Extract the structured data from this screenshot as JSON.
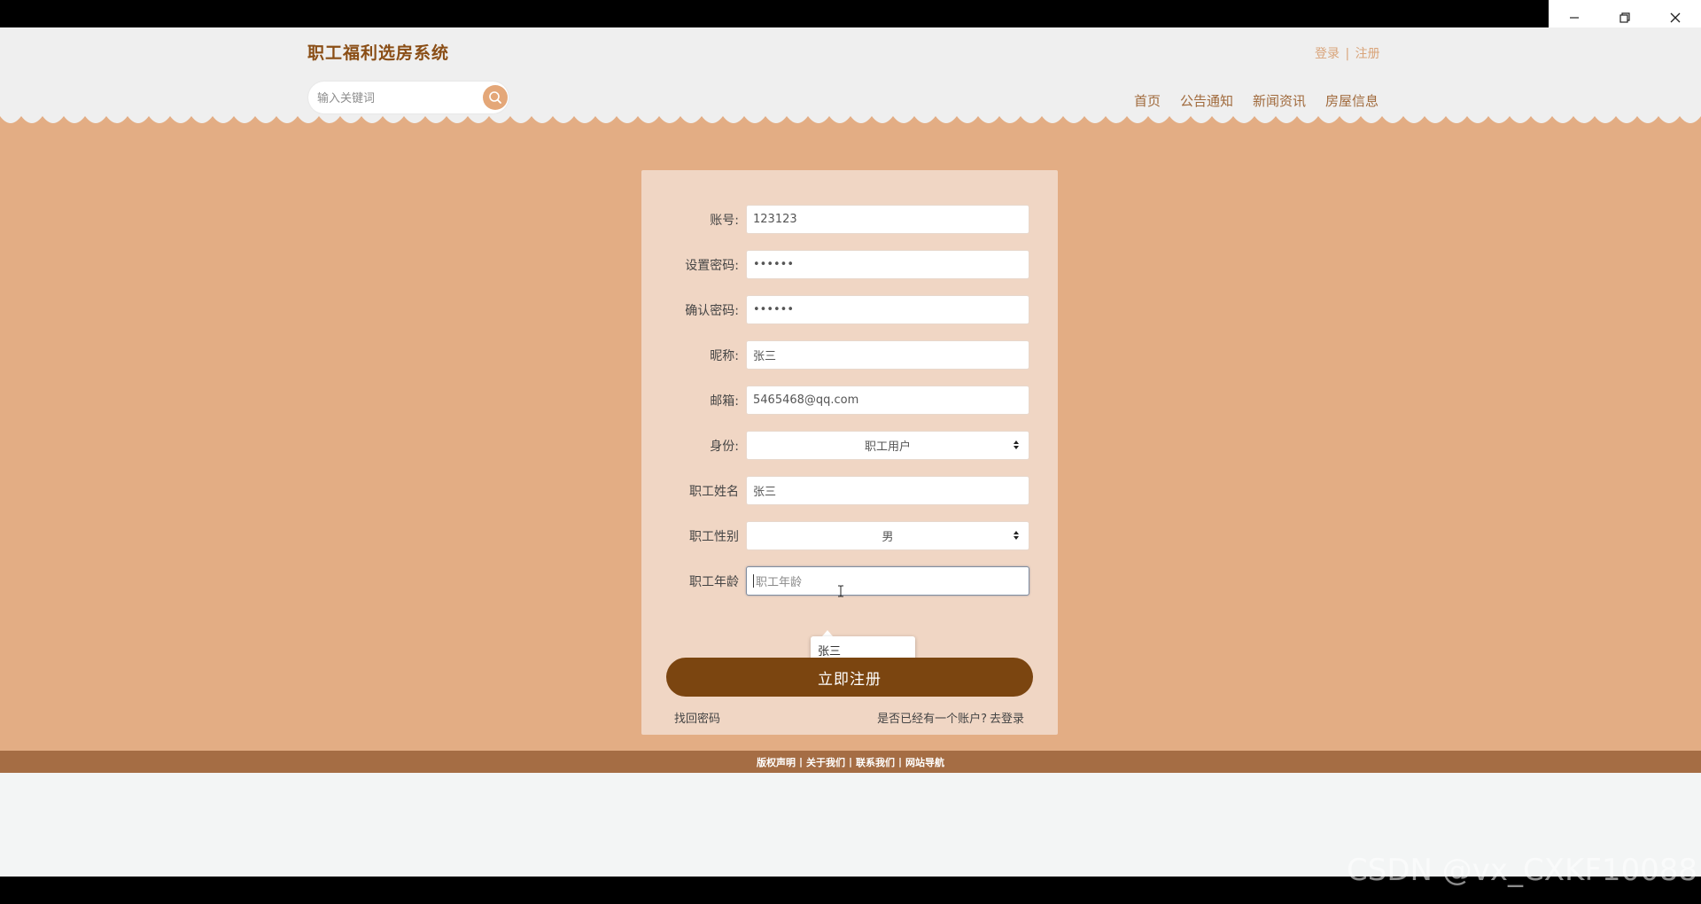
{
  "header": {
    "site_title": "职工福利选房系统",
    "login_link": "登录",
    "separator": "|",
    "register_link": "注册",
    "search": {
      "placeholder": "输入关键词"
    },
    "nav": [
      "首页",
      "公告通知",
      "新闻资讯",
      "房屋信息"
    ]
  },
  "form": {
    "fields": [
      {
        "label": "账号:",
        "value": "123123",
        "type": "text"
      },
      {
        "label": "设置密码:",
        "value": "••••••",
        "type": "password"
      },
      {
        "label": "确认密码:",
        "value": "••••••",
        "type": "password"
      },
      {
        "label": "昵称:",
        "value": "张三",
        "type": "text"
      },
      {
        "label": "邮箱:",
        "value": "5465468@qq.com",
        "type": "text"
      },
      {
        "label": "身份:",
        "value": "职工用户",
        "type": "select"
      },
      {
        "label": "职工姓名",
        "value": "张三",
        "type": "text"
      },
      {
        "label": "职工性别",
        "value": "男",
        "type": "select"
      },
      {
        "label": "职工年龄",
        "value": "",
        "placeholder": "职工年龄",
        "type": "text",
        "focused": true
      }
    ],
    "autocomplete_suggestion": "张三",
    "submit_label": "立即注册",
    "forgot_password": "找回密码",
    "have_account_text": "是否已经有一个账户?",
    "go_login": "去登录"
  },
  "footer": {
    "links": [
      "版权声明",
      "关于我们",
      "联系我们",
      "网站导航"
    ],
    "separator": "|"
  },
  "watermark": "CSDN @vx_CXKF10088",
  "colors": {
    "brand_brown": "#7b4510",
    "main_bg": "#e3ad84",
    "card_bg": "#f0d6c4",
    "footer_bg": "#a56d44",
    "title": "#8a4e16"
  },
  "icons": [
    "minimize-icon",
    "restore-icon",
    "close-icon",
    "search-icon",
    "select-arrows-icon",
    "text-cursor-icon"
  ]
}
